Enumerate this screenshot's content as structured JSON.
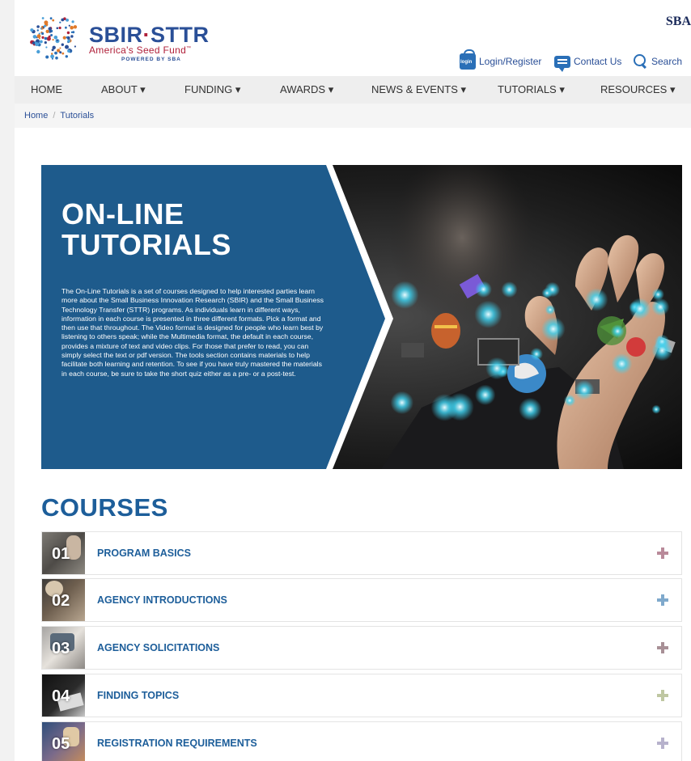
{
  "header": {
    "logo": {
      "title_left": "SBIR",
      "title_dot": "·",
      "title_right": "STTR",
      "tagline": "America's Seed Fund",
      "tagline_mark": "™",
      "powered_by": "POWERED BY SBA"
    },
    "sba_mark": "SBA",
    "utility_links": {
      "login": "Login/Register",
      "login_icon_text": "login",
      "contact": "Contact Us",
      "search": "Search"
    }
  },
  "nav": {
    "items": [
      {
        "label": "HOME"
      },
      {
        "label": "ABOUT ▾"
      },
      {
        "label": "FUNDING ▾"
      },
      {
        "label": "AWARDS ▾"
      },
      {
        "label": "NEWS & EVENTS ▾"
      },
      {
        "label": "TUTORIALS ▾"
      },
      {
        "label": "RESOURCES ▾"
      }
    ]
  },
  "breadcrumb": {
    "home": "Home",
    "separator": "/",
    "current": "Tutorials"
  },
  "hero": {
    "title": "ON-LINE\nTUTORIALS",
    "body": "The On-Line Tutorials is a set of courses designed to help interested parties learn more about the Small Business Innovation Research (SBIR) and the Small Business Technology Transfer (STTR) programs. As individuals learn in different ways, information in each course is presented in three different formats. Pick a format and then use that throughout. The Video format is designed for people who learn best by listening to others speak; while the Multimedia format, the default in each course, provides a mixture of text and video clips. For those that prefer to read, you can simply select the text or pdf version. The tools section contains materials to help facilitate both learning and retention. To see if you have truly mastered the materials in each course, be sure to take the short quiz either as a pre- or a post-test."
  },
  "courses": {
    "heading": "COURSES",
    "items": [
      {
        "number": "01",
        "title": "PROGRAM BASICS",
        "plus_color": "#b98a9a"
      },
      {
        "number": "02",
        "title": "AGENCY INTRODUCTIONS",
        "plus_color": "#7fa9cc"
      },
      {
        "number": "03",
        "title": "AGENCY SOLICITATIONS",
        "plus_color": "#a89096"
      },
      {
        "number": "04",
        "title": "FINDING TOPICS",
        "plus_color": "#bfc7a2"
      },
      {
        "number": "05",
        "title": "REGISTRATION REQUIREMENTS",
        "plus_color": "#b7b2cc"
      }
    ]
  },
  "colors": {
    "brand_blue": "#2a4f97",
    "brand_red": "#b0213a",
    "hero_blue": "#1e5b8c",
    "heading_blue": "#1d5e9a"
  }
}
